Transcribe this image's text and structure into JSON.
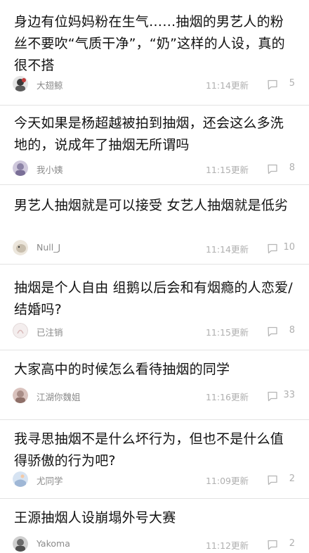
{
  "posts": [
    {
      "title": "身边有位妈妈粉在生气……抽烟的男艺人的粉丝不要吹“气质干净”，“奶”这样的人设，真的很不搭",
      "author": "大翅鲸",
      "time": "11:14更新",
      "comments": "5",
      "avatar_color": "#3a3a3a"
    },
    {
      "title": "今天如果是杨超越被拍到抽烟，还会这么多洗地的，说成年了抽烟无所谓吗",
      "author": "我小姨",
      "time": "11:15更新",
      "comments": "8",
      "avatar_color": "#8c83a6"
    },
    {
      "title": "男艺人抽烟就是可以接受 女艺人抽烟就是低劣",
      "author": "Null_J",
      "time": "11:14更新",
      "comments": "10",
      "avatar_color": "#c9bfae"
    },
    {
      "title": "抽烟是个人自由 组鹅以后会和有烟瘾的人恋爱/结婚吗?",
      "author": "已注销",
      "time": "11:15更新",
      "comments": "8",
      "avatar_color": "#e6dede"
    },
    {
      "title": "大家高中的时候怎么看待抽烟的同学",
      "author": "江湖你魏姐",
      "time": "11:16更新",
      "comments": "33",
      "avatar_color": "#a98d87"
    },
    {
      "title": "我寻思抽烟不是什么坏行为，但也不是什么值得骄傲的行为吧?",
      "author": "尤同学",
      "time": "11:09更新",
      "comments": "2",
      "avatar_color": "#9fb7d6"
    },
    {
      "title": "王源抽烟人设崩塌外号大赛",
      "author": "Yakoma",
      "time": "11:12更新",
      "comments": "2",
      "avatar_color": "#6b6b6b"
    }
  ]
}
